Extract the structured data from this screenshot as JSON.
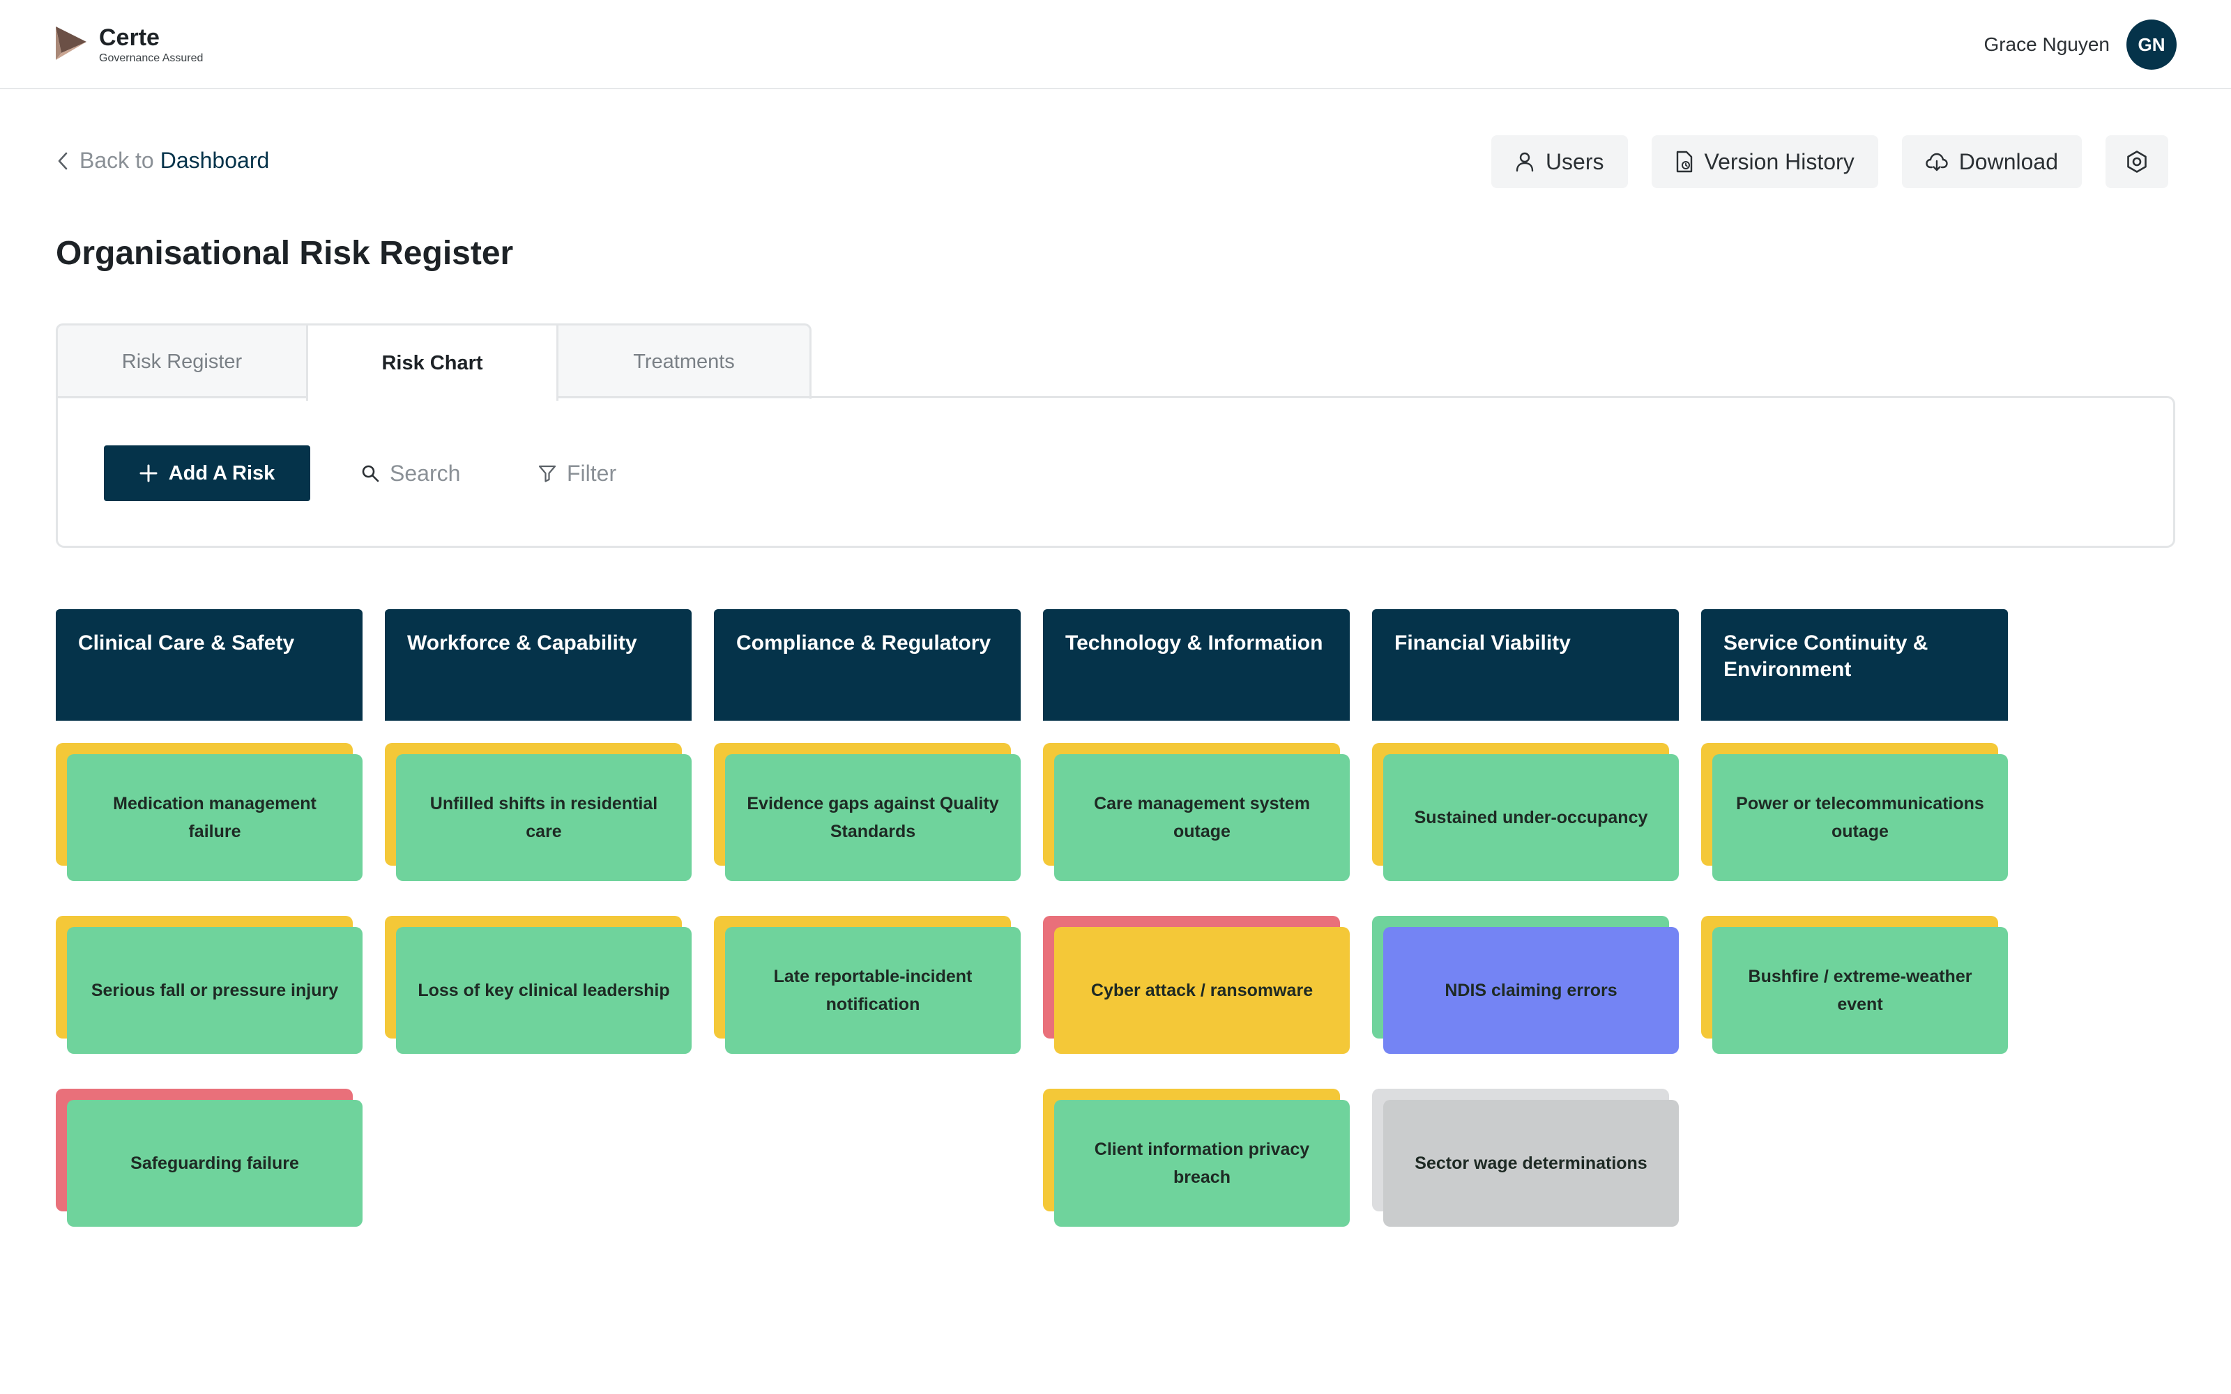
{
  "app": {
    "name": "Certe",
    "tagline": "Governance Assured"
  },
  "user": {
    "name": "Grace Nguyen",
    "initials": "GN"
  },
  "nav": {
    "back_prefix": "Back to",
    "back_link": "Dashboard"
  },
  "actions": {
    "users": "Users",
    "version_history": "Version History",
    "download": "Download",
    "settings_icon": "settings-icon"
  },
  "page": {
    "title": "Organisational Risk Register"
  },
  "tabs": [
    {
      "label": "Risk Register",
      "active": false
    },
    {
      "label": "Risk Chart",
      "active": true
    },
    {
      "label": "Treatments",
      "active": false
    }
  ],
  "toolbar": {
    "add_label": "Add A Risk",
    "search_label": "Search",
    "filter_label": "Filter"
  },
  "colors": {
    "primary": "#05334a",
    "green": "#6fd39c",
    "amber": "#f4c838",
    "red": "#e9707a",
    "blue": "#7484f4",
    "grey": "#cacccd",
    "grey_light": "#dcdddf"
  },
  "board": {
    "columns": [
      {
        "title": "Clinical Care & Safety",
        "cards": [
          {
            "label": "Medication management failure",
            "front": "green",
            "back": "amber"
          },
          {
            "label": "Serious fall or pressure injury",
            "front": "green",
            "back": "amber"
          },
          {
            "label": "Safeguarding failure",
            "front": "green",
            "back": "red"
          }
        ]
      },
      {
        "title": "Workforce & Capability",
        "cards": [
          {
            "label": "Unfilled shifts in residential care",
            "front": "green",
            "back": "amber"
          },
          {
            "label": "Loss of key clinical leadership",
            "front": "green",
            "back": "amber"
          }
        ]
      },
      {
        "title": "Compliance & Regulatory",
        "cards": [
          {
            "label": "Evidence gaps against Quality Standards",
            "front": "green",
            "back": "amber"
          },
          {
            "label": "Late reportable-incident notification",
            "front": "green",
            "back": "amber"
          }
        ]
      },
      {
        "title": "Technology & Information",
        "cards": [
          {
            "label": "Care management system outage",
            "front": "green",
            "back": "amber"
          },
          {
            "label": "Cyber attack / ransomware",
            "front": "amber",
            "back": "red"
          },
          {
            "label": "Client information privacy breach",
            "front": "green",
            "back": "amber"
          }
        ]
      },
      {
        "title": "Financial Viability",
        "cards": [
          {
            "label": "Sustained under-occupancy",
            "front": "green",
            "back": "amber"
          },
          {
            "label": "NDIS claiming errors",
            "front": "blue",
            "back": "green"
          },
          {
            "label": "Sector wage determinations",
            "front": "grey",
            "back": "grey_light"
          }
        ]
      },
      {
        "title": "Service Continuity & Environment",
        "cards": [
          {
            "label": "Power or telecommunications outage",
            "front": "green",
            "back": "amber"
          },
          {
            "label": "Bushfire / extreme-weather event",
            "front": "green",
            "back": "amber"
          }
        ]
      }
    ]
  }
}
